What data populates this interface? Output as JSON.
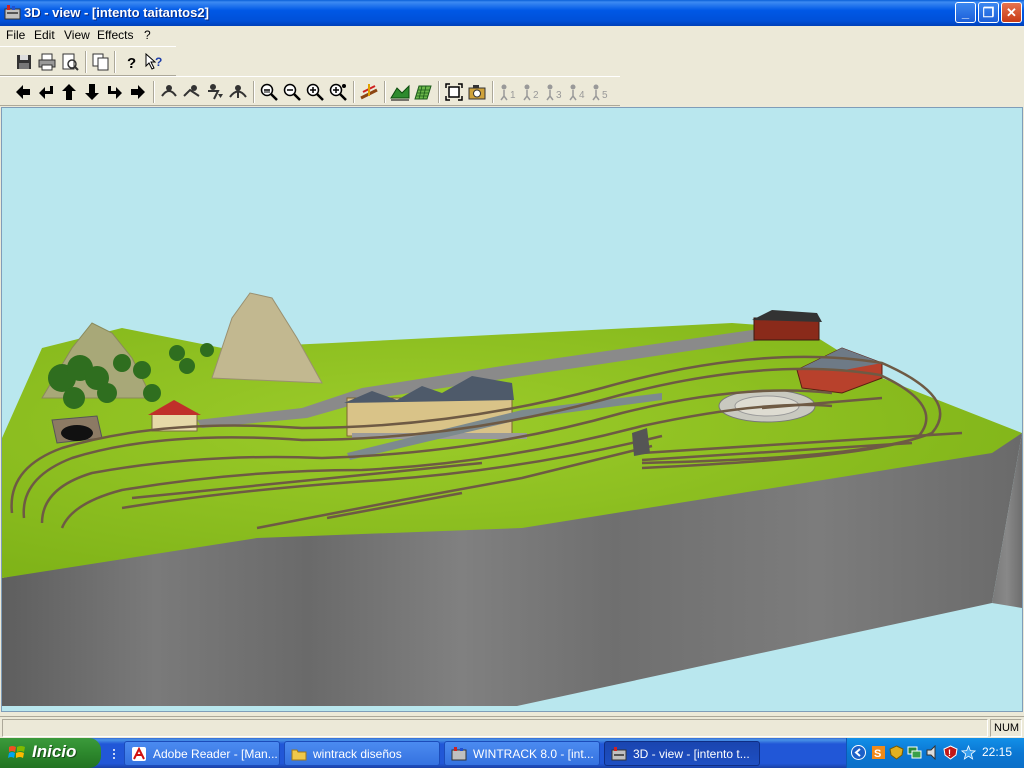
{
  "window": {
    "title": "3D - view - [intento taitantos2]",
    "minimize": "_",
    "restore": "❐",
    "close": "✕"
  },
  "menu": [
    "File",
    "Edit",
    "View",
    "Effects",
    "?"
  ],
  "toolbar1": [
    "save-icon",
    "print-icon",
    "print-preview-icon",
    "copy-icon",
    "help-icon",
    "context-help-icon"
  ],
  "toolbar2": {
    "navigation": [
      "arrow-left-icon",
      "turn-left-icon",
      "arrow-up-icon",
      "arrow-down-icon",
      "turn-right-icon",
      "arrow-right-icon"
    ],
    "walker": [
      "walker-1-icon",
      "walker-2-icon",
      "walker-3-icon",
      "walker-4-icon"
    ],
    "zoom": [
      "zoom-out-all-icon",
      "zoom-out-icon",
      "zoom-in-icon",
      "zoom-in-all-icon"
    ],
    "camera_labels": [
      "1",
      "2",
      "3",
      "4",
      "5"
    ]
  },
  "status": {
    "num": "NUM"
  },
  "taskbar": {
    "start": "Inicio",
    "tasks": [
      {
        "label": "Adobe Reader - [Man...",
        "icon": "adobe-reader-icon"
      },
      {
        "label": "wintrack diseños",
        "icon": "folder-icon"
      },
      {
        "label": "WINTRACK 8.0 - [int...",
        "icon": "wintrack-icon"
      },
      {
        "label": "3D - view - [intento t...",
        "icon": "3d-view-icon",
        "active": true
      }
    ],
    "clock": "22:15"
  },
  "colors": {
    "sky": "#b9e7ee",
    "terrain": "#8cc21e",
    "cliff": "#707070",
    "titlebar": "#0058e6"
  }
}
